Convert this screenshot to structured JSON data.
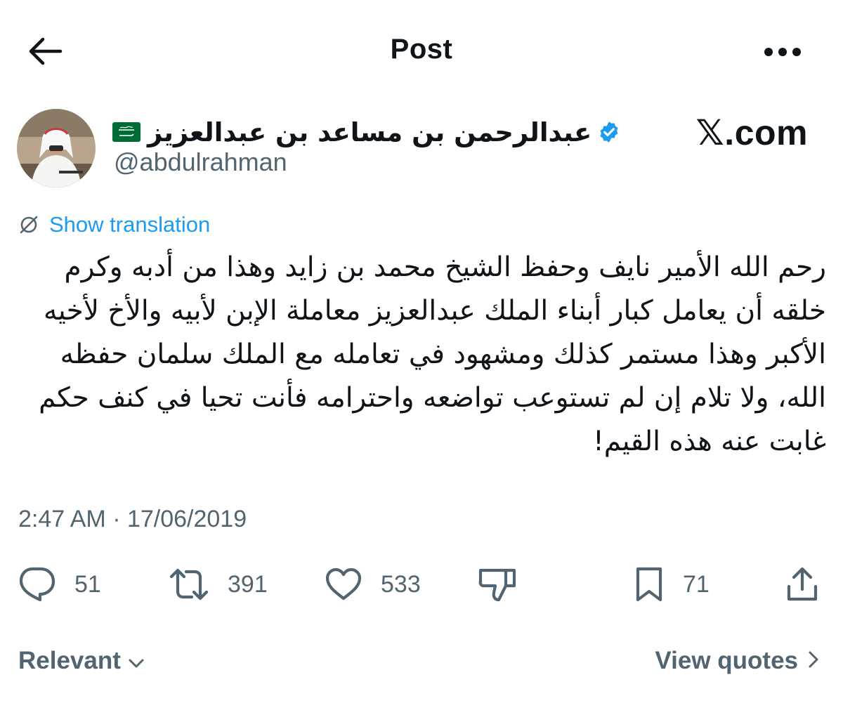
{
  "header": {
    "title": "Post",
    "back_icon": "arrow-left-icon",
    "more_icon": "more-horizontal-icon"
  },
  "author": {
    "display_name": "عبدالرحمن بن مساعد بن عبدالعزيز",
    "flag_icon": "saudi-flag-icon",
    "verified_icon": "verified-badge-icon",
    "handle": "@abdulrahman"
  },
  "watermark": "𝕏.com",
  "translation": {
    "label": "Show translation",
    "icon": "translate-off-icon"
  },
  "tweet": {
    "text": "رحم الله الأمير نايف وحفظ الشيخ محمد بن زايد وهذا من أدبه وكرم خلقه أن يعامل كبار أبناء الملك عبدالعزيز معاملة الإبن لأبيه والأخ لأخيه الأكبر وهذا مستمر كذلك ومشهود في تعامله مع الملك سلمان حفظه الله، ولا تلام إن لم تستوعب تواضعه واحترامه فأنت تحيا في كنف حكم غابت عنه هذه القيم!",
    "timestamp": "2:47 AM · 17/06/2019"
  },
  "actions": {
    "replies": "51",
    "reposts": "391",
    "likes": "533",
    "bookmarks": "71",
    "icons": [
      "reply-icon",
      "repost-icon",
      "like-icon",
      "downvote-icon",
      "bookmark-icon",
      "share-icon"
    ]
  },
  "footer": {
    "sort_label": "Relevant",
    "view_quotes_label": "View quotes"
  },
  "colors": {
    "text": "#0f1419",
    "secondary": "#536471",
    "accent": "#1d9bf0",
    "flag_green": "#006c35"
  }
}
